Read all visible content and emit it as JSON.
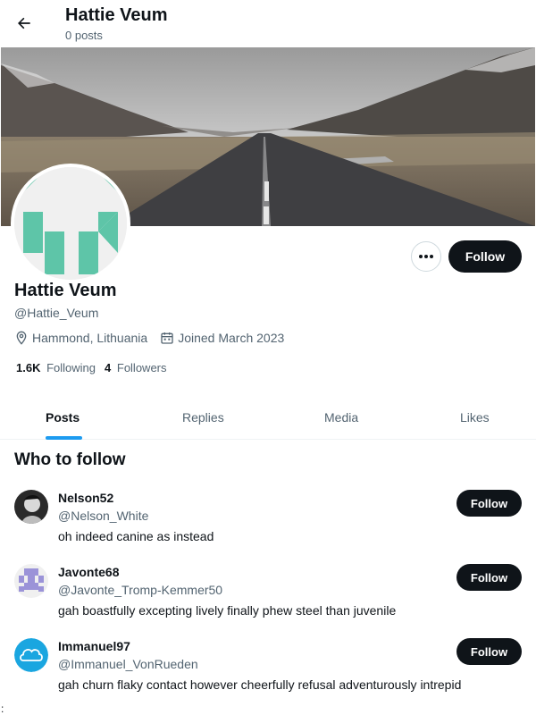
{
  "header": {
    "title": "Hattie Veum",
    "subtitle": "0 posts"
  },
  "profile": {
    "name": "Hattie Veum",
    "handle": "@Hattie_Veum",
    "location": "Hammond, Lithuania",
    "joined": "Joined March 2023",
    "following_count": "1.6K",
    "following_label": "Following",
    "followers_count": "4",
    "followers_label": "Followers",
    "follow_label": "Follow",
    "more_label": "···"
  },
  "tabs": [
    {
      "label": "Posts",
      "active": true
    },
    {
      "label": "Replies",
      "active": false
    },
    {
      "label": "Media",
      "active": false
    },
    {
      "label": "Likes",
      "active": false
    }
  ],
  "who_to_follow": {
    "title": "Who to follow",
    "items": [
      {
        "name": "Nelson52",
        "handle": "@Nelson_White",
        "bio": "oh indeed canine as instead",
        "follow_label": "Follow",
        "avatar": "photo-avatar"
      },
      {
        "name": "Javonte68",
        "handle": "@Javonte_Tromp-Kemmer50",
        "bio": "gah boastfully excepting lively finally phew steel than juvenile",
        "follow_label": "Follow",
        "avatar": "identicon-avatar"
      },
      {
        "name": "Immanuel97",
        "handle": "@Immanuel_VonRueden",
        "bio": "gah churn flaky contact however cheerfully refusal adventurously intrepid",
        "follow_label": "Follow",
        "avatar": "cloud-avatar"
      }
    ]
  },
  "edge_mark": ":",
  "colors": {
    "accent": "#1d9bf0",
    "button_dark": "#0f1419",
    "secondary_text": "#536471",
    "identicon_green": "#5ec5a8"
  }
}
